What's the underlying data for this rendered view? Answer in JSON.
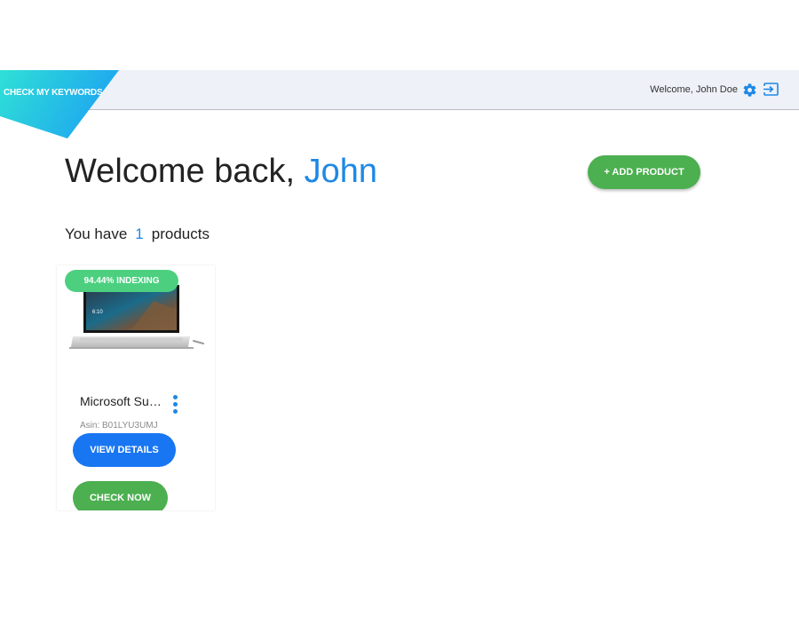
{
  "header": {
    "logo_text": "CHECK MY KEYWORDS",
    "welcome_text": "Welcome, John Doe",
    "icons": [
      "gear-icon",
      "logout-icon"
    ]
  },
  "main": {
    "greeting_prefix": "Welcome back,",
    "greeting_name": "John",
    "add_product_label": "+ ADD PRODUCT",
    "count_prefix": "You have",
    "count_value": "1",
    "count_suffix": "products"
  },
  "products": [
    {
      "badge": "94.44% INDEXING",
      "title": "Microsoft Surface Book",
      "asin": "Asin: B01LYU3UMJ",
      "view_label": "VIEW DETAILS",
      "check_label": "CHECK NOW"
    }
  ],
  "colors": {
    "accent_blue": "#1e88e5",
    "button_blue": "#1976f2",
    "green": "#4caf50",
    "badge_green": "#4cd080",
    "header_bg": "#eef1f8",
    "logo_gradient": [
      "#2fe0d6",
      "#1ea6f0"
    ]
  }
}
